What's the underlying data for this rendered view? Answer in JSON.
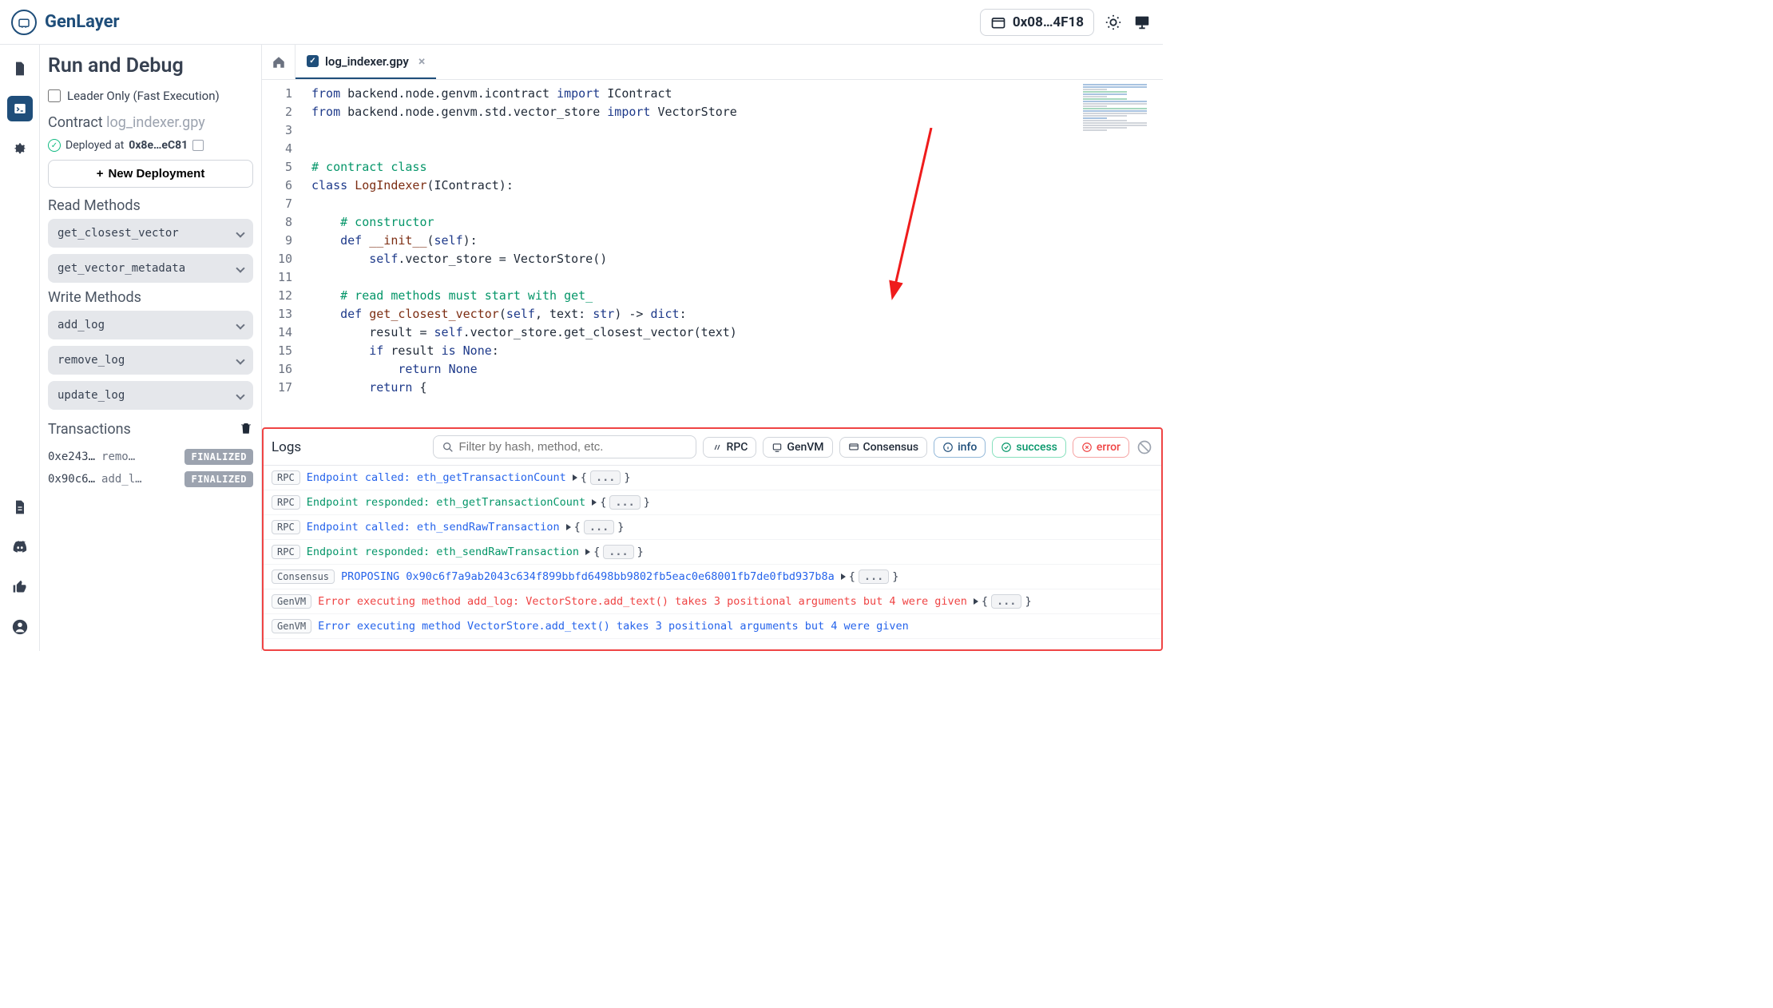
{
  "brand": {
    "name": "GenLayer"
  },
  "header": {
    "wallet_label": "0x08…4F18"
  },
  "rail": {
    "top_icons": [
      "file",
      "terminal",
      "gear"
    ],
    "bottom_icons": [
      "doc",
      "discord",
      "thumbs-up",
      "user"
    ]
  },
  "sidebar": {
    "title": "Run and Debug",
    "leader_only_label": "Leader Only (Fast Execution)",
    "contract_prefix": "Contract",
    "contract_name": "log_indexer.gpy",
    "deployed_prefix": "Deployed at",
    "deployed_addr": "0x8e…eC81",
    "new_deploy_label": "New Deployment",
    "read_methods_title": "Read Methods",
    "read_methods": [
      "get_closest_vector",
      "get_vector_metadata"
    ],
    "write_methods_title": "Write Methods",
    "write_methods": [
      "add_log",
      "remove_log",
      "update_log"
    ],
    "transactions_title": "Transactions",
    "transactions": [
      {
        "hash": "0xe243…",
        "method": "remo…",
        "status": "FINALIZED"
      },
      {
        "hash": "0x90c6…",
        "method": "add_l…",
        "status": "FINALIZED"
      }
    ]
  },
  "tabs": {
    "active_file": "log_indexer.gpy"
  },
  "code_lines": [
    {
      "n": 1,
      "html": "<span class='kw'>from</span> backend.node.genvm.icontract <span class='kw'>import</span> IContract"
    },
    {
      "n": 2,
      "html": "<span class='kw'>from</span> backend.node.genvm.std.vector_store <span class='kw'>import</span> VectorStore"
    },
    {
      "n": 3,
      "html": ""
    },
    {
      "n": 4,
      "html": ""
    },
    {
      "n": 5,
      "html": "<span class='cm'># contract class</span>"
    },
    {
      "n": 6,
      "html": "<span class='kw'>class</span> <span class='fn'>LogIndexer</span>(IContract):"
    },
    {
      "n": 7,
      "html": ""
    },
    {
      "n": 8,
      "html": "    <span class='cm'># constructor</span>"
    },
    {
      "n": 9,
      "html": "    <span class='kw'>def</span> <span class='fn'>__init__</span>(<span class='sp'>self</span>):"
    },
    {
      "n": 10,
      "html": "        <span class='sp'>self</span>.vector_store = VectorStore()"
    },
    {
      "n": 11,
      "html": ""
    },
    {
      "n": 12,
      "html": "    <span class='cm'># read methods must start with get_</span>"
    },
    {
      "n": 13,
      "html": "    <span class='kw'>def</span> <span class='fn'>get_closest_vector</span>(<span class='sp'>self</span>, text: <span class='sp'>str</span>) -> <span class='sp'>dict</span>:"
    },
    {
      "n": 14,
      "html": "        result = <span class='sp'>self</span>.vector_store.get_closest_vector(text)"
    },
    {
      "n": 15,
      "html": "        <span class='kw'>if</span> result <span class='kw'>is</span> <span class='sp'>None</span>:"
    },
    {
      "n": 16,
      "html": "            <span class='kw'>return</span> <span class='sp'>None</span>"
    },
    {
      "n": 17,
      "html": "        <span class='kw'>return</span> {"
    }
  ],
  "logs": {
    "title": "Logs",
    "filter_placeholder": "Filter by hash, method, etc.",
    "chips": {
      "rpc": "RPC",
      "genvm": "GenVM",
      "consensus": "Consensus",
      "info": "info",
      "success": "success",
      "error": "error"
    },
    "entries": [
      {
        "tag": "RPC",
        "color": "blue",
        "msg": "Endpoint called: eth_getTransactionCount",
        "json": true
      },
      {
        "tag": "RPC",
        "color": "green",
        "msg": "Endpoint responded: eth_getTransactionCount",
        "json": true
      },
      {
        "tag": "RPC",
        "color": "blue",
        "msg": "Endpoint called: eth_sendRawTransaction",
        "json": true
      },
      {
        "tag": "RPC",
        "color": "green",
        "msg": "Endpoint responded: eth_sendRawTransaction",
        "json": true
      },
      {
        "tag": "Consensus",
        "color": "blue",
        "msg": "PROPOSING 0x90c6f7a9ab2043c634f899bbfd6498bb9802fb5eac0e68001fb7de0fbd937b8a",
        "json": true
      },
      {
        "tag": "GenVM",
        "color": "red",
        "msg": "Error executing method add_log: VectorStore.add_text() takes 3 positional arguments but 4 were given",
        "json": true
      },
      {
        "tag": "GenVM",
        "color": "blue",
        "msg": "Error executing method VectorStore.add_text() takes 3 positional arguments but 4 were given",
        "json": false
      }
    ]
  }
}
